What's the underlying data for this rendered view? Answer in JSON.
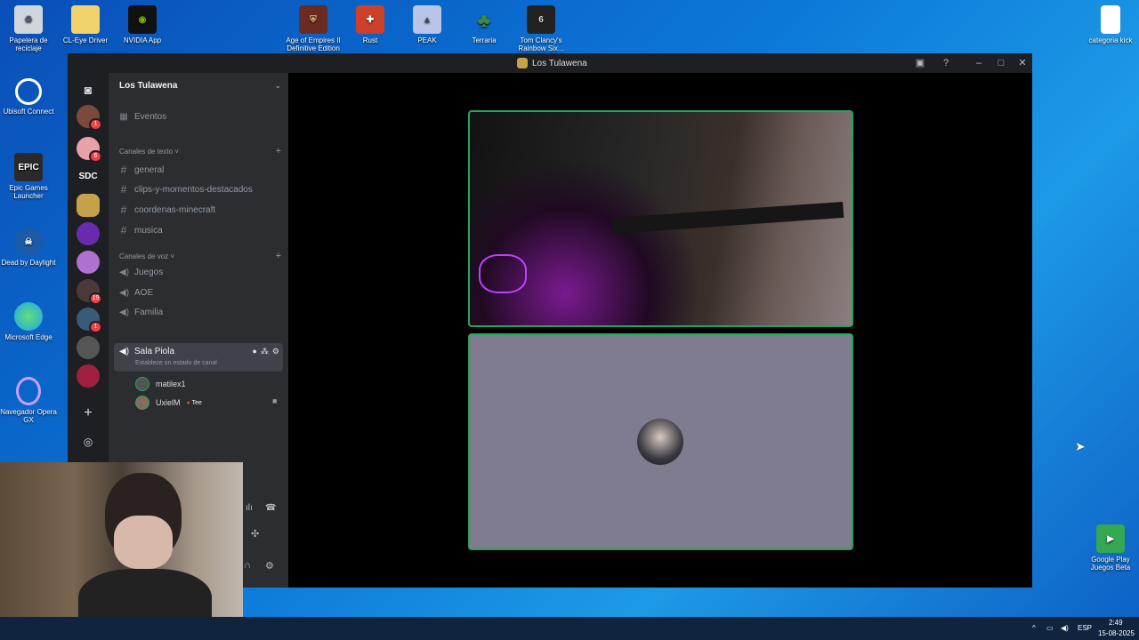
{
  "desktop": {
    "icons": [
      {
        "label": "Papelera de reciclaje",
        "icon": "recycle-bin-icon",
        "color": "#d0d8e0"
      },
      {
        "label": "CL-Eye Driver",
        "icon": "folder-icon",
        "color": "#f2d36b"
      },
      {
        "label": "NVIDIA App",
        "icon": "nvidia-icon",
        "color": "#76b900"
      },
      {
        "label": "Age of Empires II Definitive Edition",
        "icon": "aoe-icon",
        "color": "#8a2b1e"
      },
      {
        "label": "Rust",
        "icon": "rust-icon",
        "color": "#cd412b"
      },
      {
        "label": "PEAK",
        "icon": "peak-icon",
        "color": "#b8c4e8"
      },
      {
        "label": "Terraria",
        "icon": "terraria-icon",
        "color": "#3d8b3d"
      },
      {
        "label": "Tom Clancy's Rainbow Six...",
        "icon": "r6-icon",
        "color": "#222222"
      },
      {
        "label": "categoria kick",
        "icon": "document-icon",
        "color": "#ffffff"
      },
      {
        "label": "Ubisoft Connect",
        "icon": "ubisoft-icon",
        "color": "#2b78ff"
      },
      {
        "label": "Epic Games Launcher",
        "icon": "epic-icon",
        "color": "#2a2a2a"
      },
      {
        "label": "Dead by Daylight",
        "icon": "dbd-icon",
        "color": "#1b5aa8"
      },
      {
        "label": "Microsoft Edge",
        "icon": "edge-icon",
        "color": "#1fa3e8"
      },
      {
        "label": "Navegador Opera GX",
        "icon": "opera-gx-icon",
        "color": "#e83e8c"
      },
      {
        "label": "Google Play Juegos Beta",
        "icon": "google-play-icon",
        "color": "#34a853"
      }
    ]
  },
  "window": {
    "title": "Los Tulawena"
  },
  "sidebar": {
    "server_name": "Los Tulawena",
    "events_label": "Eventos",
    "text_category": "Canales de texto",
    "text_channels": [
      "general",
      "clips-y-momentos-destacados",
      "coordenas-minecraft",
      "musica"
    ],
    "voice_category": "Canales de voz",
    "voice_channels": [
      "Juegos",
      "AOE",
      "Familia"
    ],
    "active_voice": {
      "name": "Sala Piola",
      "status": "Establece un estado de canal"
    },
    "members": [
      {
        "name": "matilex1"
      },
      {
        "name": "UxielM",
        "tag": "Tee"
      }
    ]
  },
  "rail": {
    "sdc_label": "SDC",
    "badges": [
      "1",
      "6",
      "19",
      "1"
    ]
  },
  "taskbar": {
    "language": "ESP",
    "time": "2:49",
    "date": "15-08-2025"
  },
  "colors": {
    "speaking_border": "#23a55a",
    "badge": "#f23f43"
  }
}
